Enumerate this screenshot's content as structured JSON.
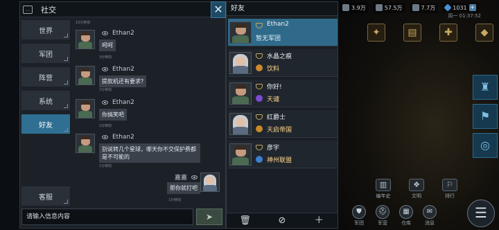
{
  "resources": [
    {
      "icon": "crystal-icon",
      "value": "3.9万"
    },
    {
      "icon": "ore-icon",
      "value": "57.5万"
    },
    {
      "icon": "fuel-icon",
      "value": "7.7万"
    },
    {
      "icon": "gem-icon",
      "value": "1031"
    }
  ],
  "clock": "周一 01:37:52",
  "social": {
    "title": "社交",
    "tabs": [
      "世界",
      "军团",
      "阵营",
      "系统",
      "好友"
    ],
    "active_tab": "好友",
    "kefu_tab": "客服",
    "input_placeholder": "请输入信息内容"
  },
  "messages": [
    {
      "name": "Ethan2",
      "text": "呵呵",
      "time": "3分钟前",
      "self": false
    },
    {
      "name": "Ethan2",
      "text": "提款机还有要求?",
      "time": "2分钟前",
      "self": false
    },
    {
      "name": "Ethan2",
      "text": "你搞笑吧",
      "time": "2分钟前",
      "self": false
    },
    {
      "name": "Ethan2",
      "text": "别说转几个星球，哪天你不交保护费都是不可能的",
      "time": "1分钟前",
      "self": false
    },
    {
      "name": "嘉嘉",
      "text": "那你就打吧",
      "time": "1分钟前",
      "self": true
    }
  ],
  "top_timestamp": "10分钟前",
  "friends": {
    "title": "好友",
    "list": [
      {
        "name": "Ethan2",
        "guild": "暂无军团",
        "avatar": "male",
        "guild_color": "none"
      },
      {
        "name": "水晶之痕",
        "guild": "饮料",
        "avatar": "female",
        "guild_color": "#c98a2a"
      },
      {
        "name": "你好!",
        "guild": "天谴",
        "avatar": "male",
        "guild_color": "#7b4bd4"
      },
      {
        "name": "红爵士",
        "guild": "天启帝国",
        "avatar": "female",
        "guild_color": "#c98a2a"
      },
      {
        "name": "彦宇",
        "guild": "神州联盟",
        "avatar": "male",
        "guild_color": "#3b80d0"
      }
    ]
  },
  "base_buttons": {
    "mid": [
      "编年史",
      "文明",
      "排行"
    ],
    "bottom": [
      "军团",
      "军营",
      "仓库",
      "消息"
    ]
  },
  "colors": {
    "accent": "#2f6f92",
    "bubble": "#3a414a",
    "guild_text": "#ffd48a"
  }
}
